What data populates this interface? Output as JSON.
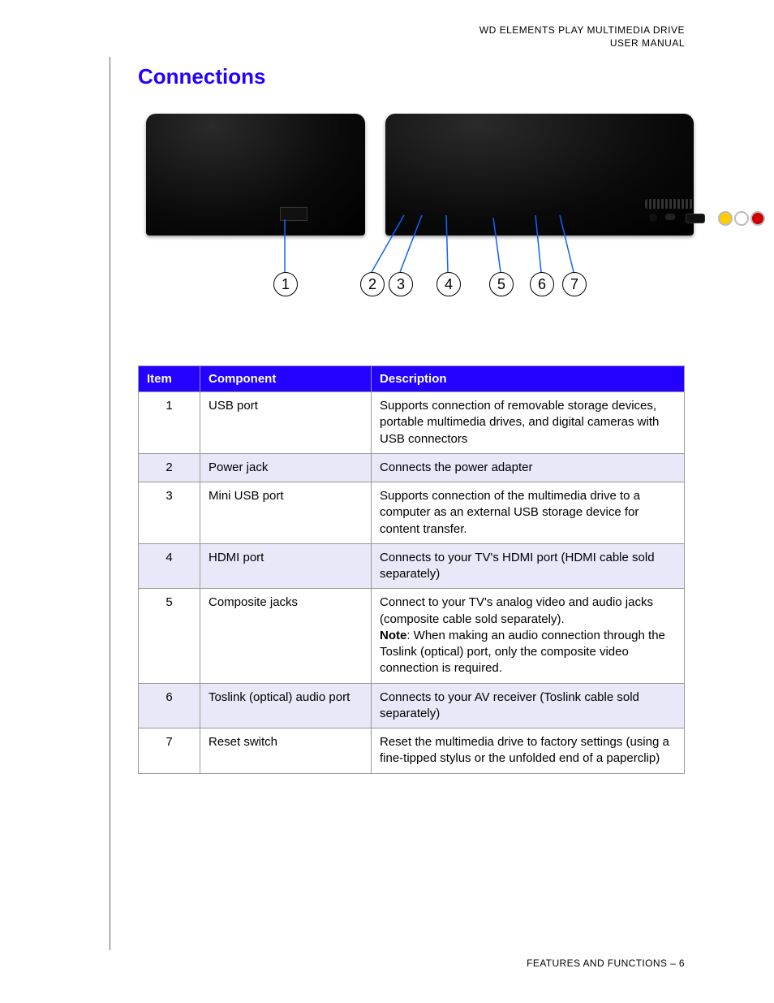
{
  "header": {
    "line1": "WD ELEMENTS PLAY MULTIMEDIA DRIVE",
    "line2": "USER MANUAL"
  },
  "title": "Connections",
  "callouts": [
    "1",
    "2",
    "3",
    "4",
    "5",
    "6",
    "7"
  ],
  "table": {
    "headers": {
      "item": "Item",
      "component": "Component",
      "description": "Description"
    },
    "rows": [
      {
        "item": "1",
        "component": "USB port",
        "description": "Supports connection of removable storage devices, portable multimedia drives, and digital cameras with USB connectors"
      },
      {
        "item": "2",
        "component": "Power jack",
        "description": "Connects the power adapter"
      },
      {
        "item": "3",
        "component": "Mini USB port",
        "description": "Supports connection of the multimedia drive to a computer as an external USB storage device for content transfer."
      },
      {
        "item": "4",
        "component": "HDMI port",
        "description": "Connects to your TV's HDMI port (HDMI cable sold separately)"
      },
      {
        "item": "5",
        "component": "Composite jacks",
        "description": "Connect to your TV's analog video and audio jacks (composite cable sold separately).",
        "note_label": "Note",
        "note_text": ": When making an audio connection through the Toslink (optical) port, only the composite video connection is required."
      },
      {
        "item": "6",
        "component": "Toslink (optical) audio port",
        "description": "Connects to your AV receiver (Toslink cable sold separately)"
      },
      {
        "item": "7",
        "component": "Reset switch",
        "description": "Reset the multimedia drive to factory settings (using a fine-tipped stylus or the unfolded end of a paperclip)"
      }
    ]
  },
  "footer": {
    "section": "FEATURES AND FUNCTIONS",
    "separator": " – ",
    "page_no": "6"
  }
}
